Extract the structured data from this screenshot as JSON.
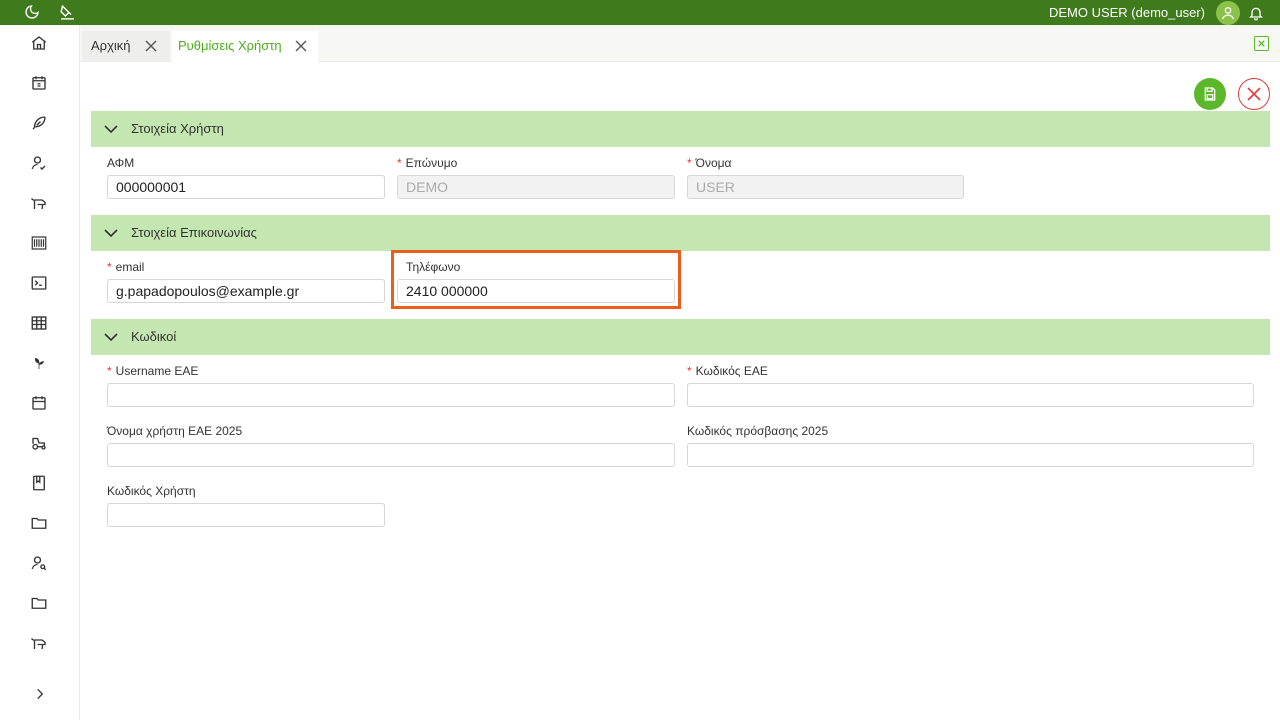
{
  "topbar": {
    "user_name": "DEMO USER (demo_user)",
    "icons": [
      "moon-icon",
      "paint-bucket-icon",
      "avatar-icon",
      "bell-icon"
    ],
    "accent_color": "#3f7a1d"
  },
  "sidebar": {
    "items": [
      "home-icon",
      "calendar-euro-icon",
      "feather-icon",
      "user-check-icon",
      "cow-icon",
      "barcode-icon",
      "terminal-icon",
      "table-icon",
      "plant-icon",
      "calendar-icon",
      "tractor-icon",
      "book-icon",
      "folder-icon",
      "user-search-icon",
      "folder-icon",
      "cow-icon"
    ],
    "expand_icon": "chevron-right-icon"
  },
  "tabs": [
    {
      "label": "Αρχική",
      "active": false
    },
    {
      "label": "Ρυθμίσεις Χρήστη",
      "active": true
    }
  ],
  "sections": {
    "user": {
      "title": "Στοιχεία Χρήστη",
      "afm_label": "ΑΦΜ",
      "afm_value": "000000001",
      "surname_label": "Επώνυμο",
      "surname_value": "DEMO",
      "name_label": "Όνομα",
      "name_value": "USER"
    },
    "contact": {
      "title": "Στοιχεία Επικοινωνίας",
      "email_label": "email",
      "email_value": "g.papadopoulos@example.gr",
      "phone_label": "Τηλέφωνο",
      "phone_value": "2410 000000"
    },
    "codes": {
      "title": "Κωδικοί",
      "username_eae_label": "Username ΕΑΕ",
      "username_eae_value": "",
      "code_eae_label": "Κωδικός ΕΑΕ",
      "code_eae_value": "",
      "username_2025_label": "Όνομα χρήστη ΕΑΕ 2025",
      "username_2025_value": "",
      "password_2025_label": "Κωδικός πρόσβασης 2025",
      "password_2025_value": "",
      "user_code_label": "Κωδικός Χρήστη",
      "user_code_value": ""
    }
  },
  "required_marker": "*",
  "colors": {
    "primary": "#5cb82a",
    "section_bg": "#c4e6b0",
    "danger": "#e03a3a",
    "highlight": "#e8601c"
  }
}
